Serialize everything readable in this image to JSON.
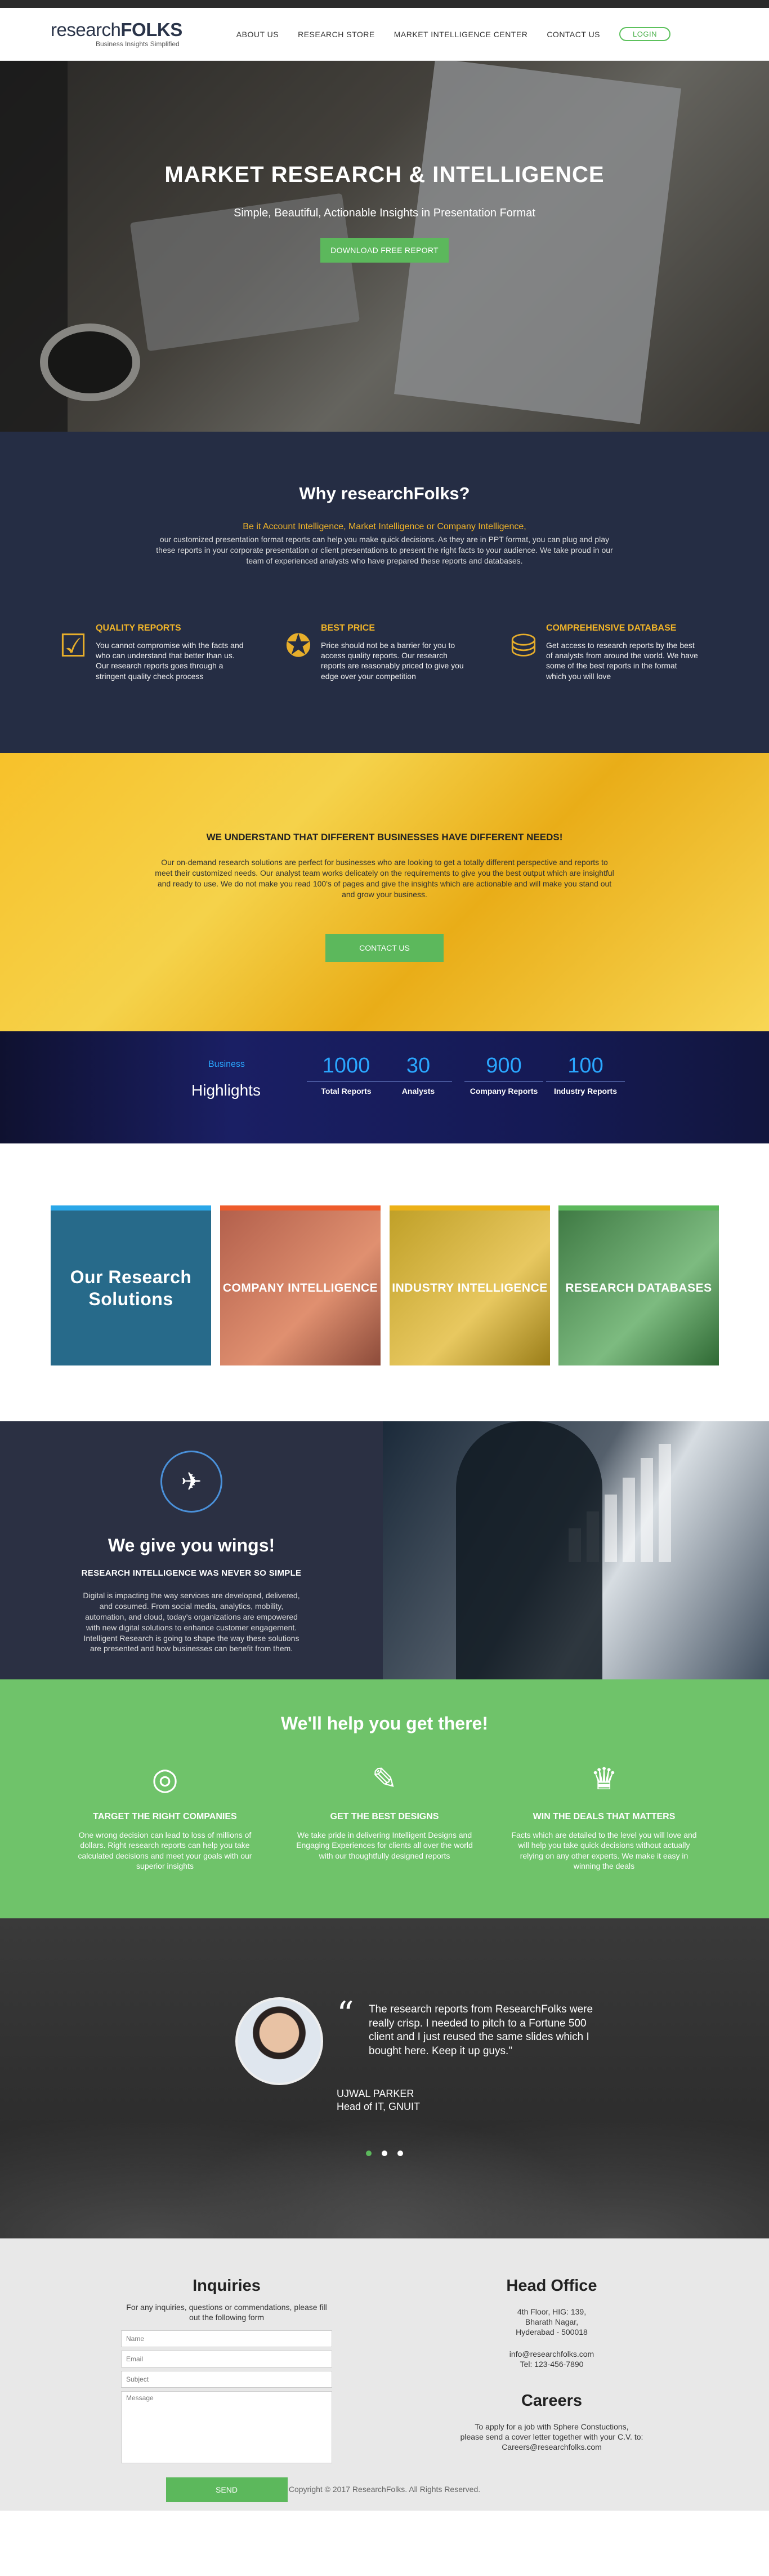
{
  "brand": {
    "logo_light": "research",
    "logo_bold": "FOLKS",
    "tagline": "Business Insights Simplified"
  },
  "nav": {
    "items": [
      "ABOUT US",
      "RESEARCH STORE",
      "MARKET INTELLIGENCE CENTER",
      "CONTACT US"
    ],
    "login": "LOGIN"
  },
  "hero": {
    "title": "MARKET RESEARCH & INTELLIGENCE",
    "subtitle": "Simple, Beautiful, Actionable Insights in Presentation Format",
    "cta": "DOWNLOAD FREE REPORT"
  },
  "why": {
    "title": "Why researchFolks?",
    "highlight": "Be it Account Intelligence, Market Intelligence or Company Intelligence,",
    "description": "our customized presentation format reports can help you make quick decisions. As they are in PPT format, you can plug and play these reports in your corporate presentation or client presentations to present the right facts to your audience. We take proud in our team of experienced analysts who have prepared these reports and databases.",
    "features": [
      {
        "icon": "certificate-check-icon",
        "title": "QUALITY REPORTS",
        "text": "You cannot compromise with the facts and who can understand that better than us. Our research reports goes through a stringent quality check process"
      },
      {
        "icon": "best-price-badge-icon",
        "title": "BEST PRICE",
        "text": "Price should not be a barrier for you to access quality reports. Our research reports are reasonably priced to give you edge over your competition"
      },
      {
        "icon": "database-search-icon",
        "title": "COMPREHENSIVE DATABASE",
        "text": "Get access to research reports by the best of analysts from around the world. We have some of the best reports in the format which you will love"
      }
    ]
  },
  "diff": {
    "title": "WE UNDERSTAND THAT DIFFERENT BUSINESSES HAVE DIFFERENT NEEDS!",
    "text": "Our on-demand research solutions are perfect for businesses who are looking to get a totally different perspective and reports to meet their customized needs. Our analyst team works delicately on the requirements to give you the best output which are insightful and ready to use. We do not make you read 100's of pages and give the insights which are actionable and will make you stand out and grow your business.",
    "cta": "CONTACT US"
  },
  "stats": {
    "label_small": "Business",
    "label_big": "Highlights",
    "items": [
      {
        "value": "1000",
        "label": "Total Reports"
      },
      {
        "value": "30",
        "label": "Analysts"
      },
      {
        "value": "900",
        "label": "Company Reports"
      },
      {
        "value": "100",
        "label": "Industry Reports"
      }
    ]
  },
  "solutions": {
    "title": "Our Research Solutions",
    "items": [
      "COMPANY INTELLIGENCE",
      "INDUSTRY INTELLIGENCE",
      "RESEARCH DATABASES"
    ]
  },
  "wings": {
    "title": "We give you wings!",
    "subtitle": "RESEARCH INTELLIGENCE WAS NEVER SO SIMPLE",
    "text": "Digital is impacting the way services are developed, delivered, and cosumed. From social media, analytics, mobility, automation, and cloud, today's organizations are empowered with new digital solutions to enhance customer engagement. Intelligent Research is going to shape the way these solutions are presented and how businesses can benefit from them."
  },
  "help": {
    "title": "We'll help you get there!",
    "cols": [
      {
        "icon": "target-icon",
        "title": "TARGET THE RIGHT COMPANIES",
        "text": "One wrong decision can lead to loss of millions of dollars. Right research reports can help you take calculated decisions and meet your goals with our superior insights"
      },
      {
        "icon": "design-pencil-icon",
        "title": "GET THE BEST DESIGNS",
        "text": "We take pride in delivering Intelligent Designs and Engaging Experiences for clients all over the world with our thoughtfully designed reports"
      },
      {
        "icon": "trophy-icon",
        "title": "WIN THE DEALS THAT MATTERS",
        "text": "Facts which are detailed to the level you will love and will help you take quick decisions without actually relying on any other experts. We make it easy in winning the deals"
      }
    ]
  },
  "testimonial": {
    "quote": "The research reports from ResearchFolks were really crisp. I needed to pitch to a Fortune 500 client and I just reused the same slides which I bought here. Keep it up guys.\"",
    "name": "UJWAL PARKER",
    "role": "Head of IT, GNUIT"
  },
  "inquiries": {
    "title": "Inquiries",
    "text": "For any inquiries, questions or commendations, please fill out the following form",
    "name_ph": "Name",
    "email_ph": "Email",
    "subject_ph": "Subject",
    "message_ph": "Message",
    "send": "SEND"
  },
  "office": {
    "title": "Head Office",
    "lines": [
      "4th Floor, HIG: 139,",
      "Bharath Nagar,",
      "Hyderabad - 500018"
    ],
    "email": "info@researchfolks.com",
    "tel": "Tel: 123-456-7890"
  },
  "careers": {
    "title": "Careers",
    "lines": [
      "To apply for a job with Sphere Constuctions,",
      "please send a cover letter together with your C.V. to:",
      "Careers@researchfolks.com"
    ]
  },
  "footer": {
    "copyright": "Copyright © 2017 ResearchFolks. All Rights Reserved."
  },
  "colors": {
    "accent_green": "#5cb85c",
    "navy": "#252d44",
    "gold": "#f0b429",
    "blue": "#2aa7ff"
  }
}
